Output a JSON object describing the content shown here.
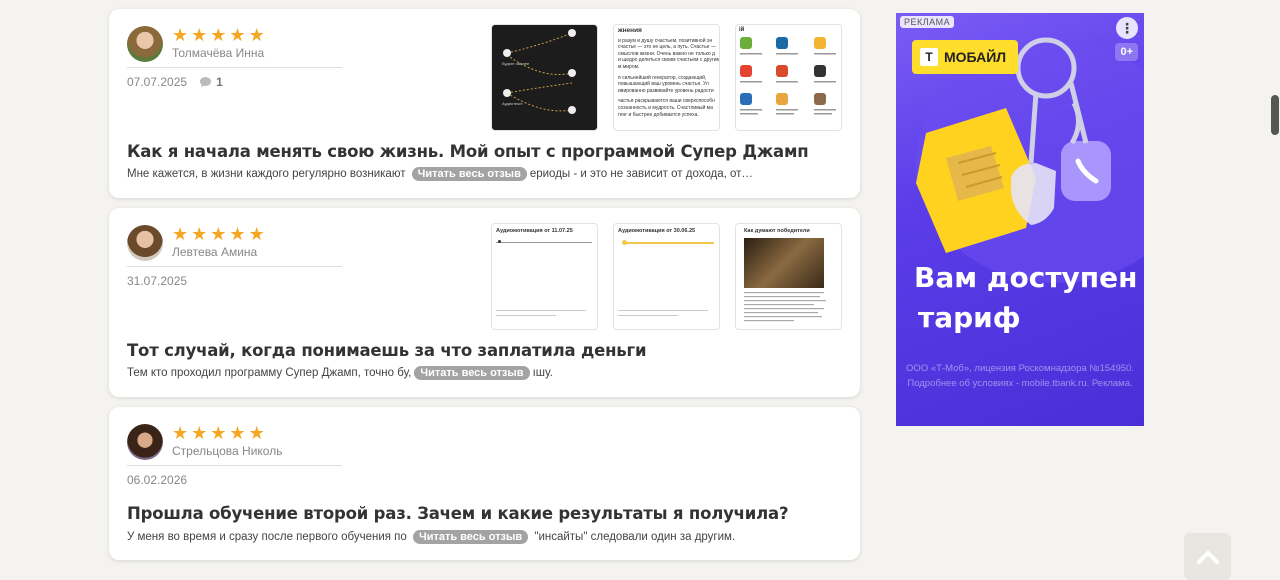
{
  "reviews": [
    {
      "author": "Толмачёва Инна",
      "rating": 5,
      "date": "07.07.2025",
      "comments": "1",
      "title": "Как я начала менять свою жизнь. Мой опыт с программой Супер Джамп",
      "excerpt_before": "Мне кажется, в жизни каждого регулярно возникают ",
      "excerpt_after": "ериоды - и это не зависит от дохода, от…",
      "thumb_texts": [
        [
          "Будьте смелее",
          "Аудиотекст"
        ],
        [
          "жнения",
          "и разум и душу счастьем, позитивной эн",
          "счастье — это не цель, а путь. Счастье —",
          "смыслов жизни. Очень важно не только д",
          "и щедро делиться своим счастьем с другим",
          "м миром.",
          "я сильнейший генератор, создающий,",
          "повышающий ваш уровень счастья. Ул",
          "ивированно развивайте уровень радости",
          "частья раскрываются ваши сверхспособн",
          "сознанность и мудрость. Счастливый ма",
          "генг и быстрее добивается успеха."
        ],
        [
          "ій"
        ]
      ]
    },
    {
      "author": "Левтева Амина",
      "rating": 5,
      "date": "31.07.2025",
      "comments": "",
      "title": "Тот случай, когда понимаешь за что заплатила деньги",
      "excerpt_before": "Тем кто проходил программу Супер Джамп, точно бу,",
      "excerpt_after": "ıшу.",
      "thumb_texts": [
        [
          "Аудиомотивация от 11.07.25"
        ],
        [
          "Аудиомотивация от 30.06.25"
        ],
        [
          "Как думают победители"
        ]
      ]
    },
    {
      "author": "Стрельцова Николь",
      "rating": 5,
      "date": "06.02.2026",
      "comments": "",
      "title": "Прошла обучение второй раз. Зачем и какие результаты я получила?",
      "excerpt_before": "У меня во время и сразу после первого обучения по ",
      "excerpt_after": " \"инсайты\" следовали один за другим.",
      "thumb_texts": []
    }
  ],
  "read_more_label": "Читать весь отзыв",
  "ad": {
    "tag": "РЕКЛАМА",
    "age": "0+",
    "brand": "МОБАЙЛ",
    "brand_letter": "Т",
    "headline_1": "Вам доступен",
    "headline_2": "тариф",
    "fine_1": "ООО «Т-Моб», лицензия Роскомнадзора №154950.",
    "fine_2": "Подробнее об условиях - mobile.tbank.ru. Реклама.",
    "more_symbol": "⋮"
  },
  "colors": {
    "star": "#f5a623",
    "badge": "#a3a3a3",
    "ad_bg": "#5a3de8",
    "logo": "#ffdd2d"
  }
}
